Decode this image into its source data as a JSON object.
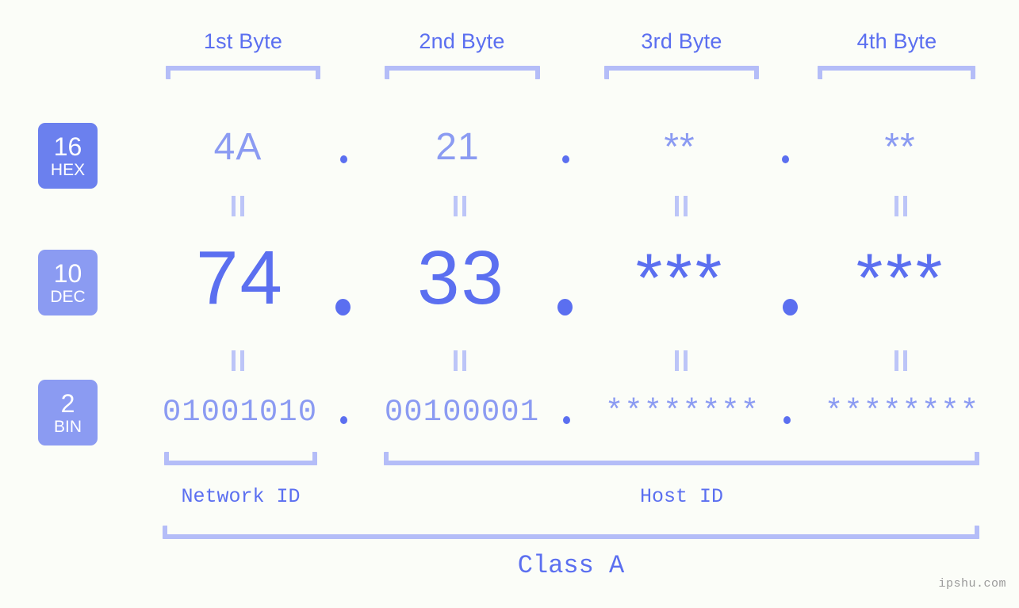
{
  "watermark": "ipshu.com",
  "background_color": "#fbfdf8",
  "colors": {
    "accent_strong": "#5b6ff0",
    "accent_light": "#8b9bf2",
    "bracket": "#b4bdf8",
    "separator": "#bcc5f8",
    "badge_primary": "#6b80ee",
    "badge_secondary": "#8b9bf2"
  },
  "byte_headers": [
    {
      "label": "1st Byte"
    },
    {
      "label": "2nd Byte"
    },
    {
      "label": "3rd Byte"
    },
    {
      "label": "4th Byte"
    }
  ],
  "rows": {
    "hex": {
      "badge_number": "16",
      "badge_system": "HEX",
      "values": [
        "4A",
        "21",
        "**",
        "**"
      ],
      "separator": "."
    },
    "dec": {
      "badge_number": "10",
      "badge_system": "DEC",
      "values": [
        "74",
        "33",
        "***",
        "***"
      ],
      "separator": "."
    },
    "bin": {
      "badge_number": "2",
      "badge_system": "BIN",
      "values": [
        "01001010",
        "00100001",
        "********",
        "********"
      ],
      "separator": "."
    }
  },
  "equality_marks": {
    "glyph": "=",
    "count": 8
  },
  "id_sections": [
    {
      "label": "Network ID"
    },
    {
      "label": "Host ID"
    }
  ],
  "class_label": "Class A"
}
